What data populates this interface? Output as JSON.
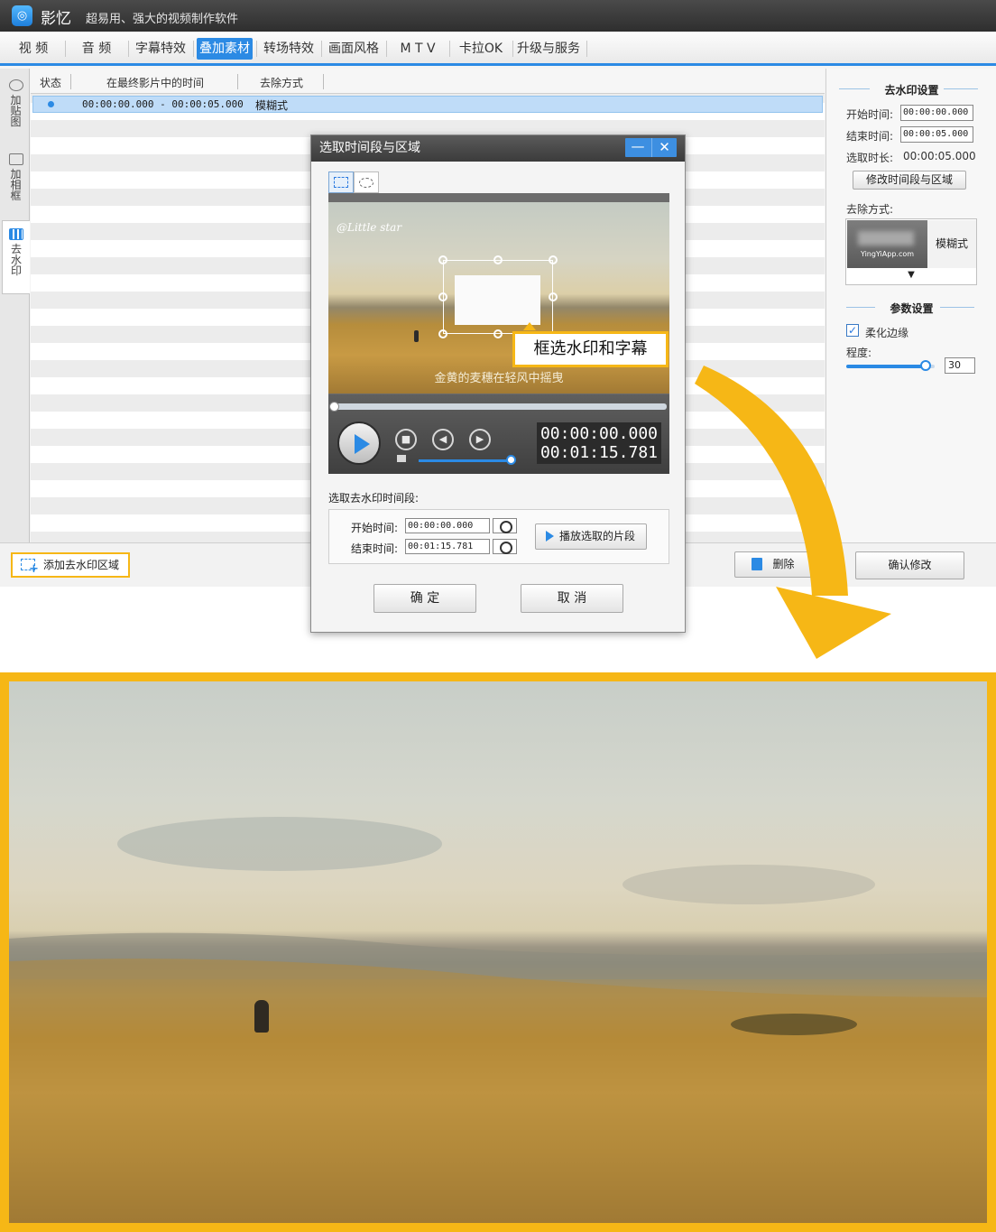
{
  "app": {
    "logo_glyph": "◎",
    "name": "影忆",
    "slogan": "超易用、强大的视频制作软件"
  },
  "menu": [
    {
      "label": "视 频"
    },
    {
      "label": "音 频"
    },
    {
      "label": "字幕特效"
    },
    {
      "label": "叠加素材",
      "active": true
    },
    {
      "label": "转场特效"
    },
    {
      "label": "画面风格"
    },
    {
      "label": "M T V"
    },
    {
      "label": "卡拉OK"
    },
    {
      "label": "升级与服务"
    }
  ],
  "sidebar": {
    "tabs": [
      {
        "label": "加贴图",
        "icon": "sticker-icon"
      },
      {
        "label": "加相框",
        "icon": "frame-icon"
      },
      {
        "label": "去水印",
        "icon": "watermark-icon",
        "active": true
      }
    ]
  },
  "list": {
    "columns": [
      "状态",
      "在最终影片中的时间",
      "去除方式"
    ],
    "rows": [
      {
        "time": "00:00:00.000 - 00:00:05.000",
        "method": "模糊式"
      }
    ]
  },
  "right_panel": {
    "title": "去水印设置",
    "start_label": "开始时间:",
    "start_value": "00:00:00.000",
    "end_label": "结束时间:",
    "end_value": "00:00:05.000",
    "duration_label": "选取时长:",
    "duration_value": "00:00:05.000",
    "modify_button": "修改时间段与区域",
    "method_label": "去除方式:",
    "method_thumb_text": "YingYiApp.com",
    "method_name": "模糊式",
    "method_arrow": "▼",
    "params_title": "参数设置",
    "soften_label": "柔化边缘",
    "soften_checked": true,
    "degree_label": "程度:",
    "degree_value": "30",
    "degree_level": 0.9
  },
  "bottom": {
    "add_region_button": "添加去水印区域",
    "delete_button": "删除",
    "confirm_button": "确认修改"
  },
  "dialog": {
    "title": "选取时间段与区域",
    "minimize_glyph": "—",
    "close_glyph": "✕",
    "preview_watermark": "@Little star",
    "preview_subtitle": "金黄的麦穗在轻风中摇曳",
    "callout": "框选水印和字幕",
    "progress_level": 0.0,
    "volume_level": 0.96,
    "stop_glyph": "■",
    "prev_glyph": "◀",
    "next_glyph": "▶",
    "current_time": "00:00:00.000",
    "total_time": "00:01:15.781",
    "segment_label": "选取去水印时间段:",
    "start_label": "开始时间:",
    "start_value": "00:00:00.000",
    "end_label": "结束时间:",
    "end_value": "00:01:15.781",
    "play_segment_button": "播放选取的片段",
    "ok_button": "确 定",
    "cancel_button": "取 消"
  },
  "colors": {
    "accent": "#2b8ae4",
    "highlight": "#f6b716",
    "titlebar": "#3a3a3a"
  }
}
